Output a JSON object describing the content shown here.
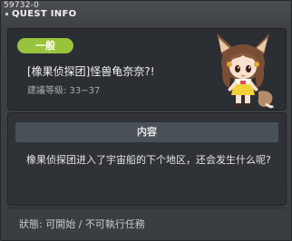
{
  "window": {
    "id_label": "59732-0",
    "title": "QUEST INFO"
  },
  "quest": {
    "category": "一般",
    "title": "[橡果侦探团]怪兽龟奈奈?!",
    "level": "建議等級: 33~37"
  },
  "content": {
    "section_label": "内容",
    "description": "橡果侦探团进入了宇宙船的下个地区，还会发生什么呢?"
  },
  "footer": {
    "status": "狀態: 可開始 / 不可執行任務"
  },
  "colors": {
    "badge": "#97c43c",
    "background": "#3b3e42",
    "panel": "#2b2e32"
  },
  "icons": {
    "npc": "fox-girl-npc-portrait"
  }
}
